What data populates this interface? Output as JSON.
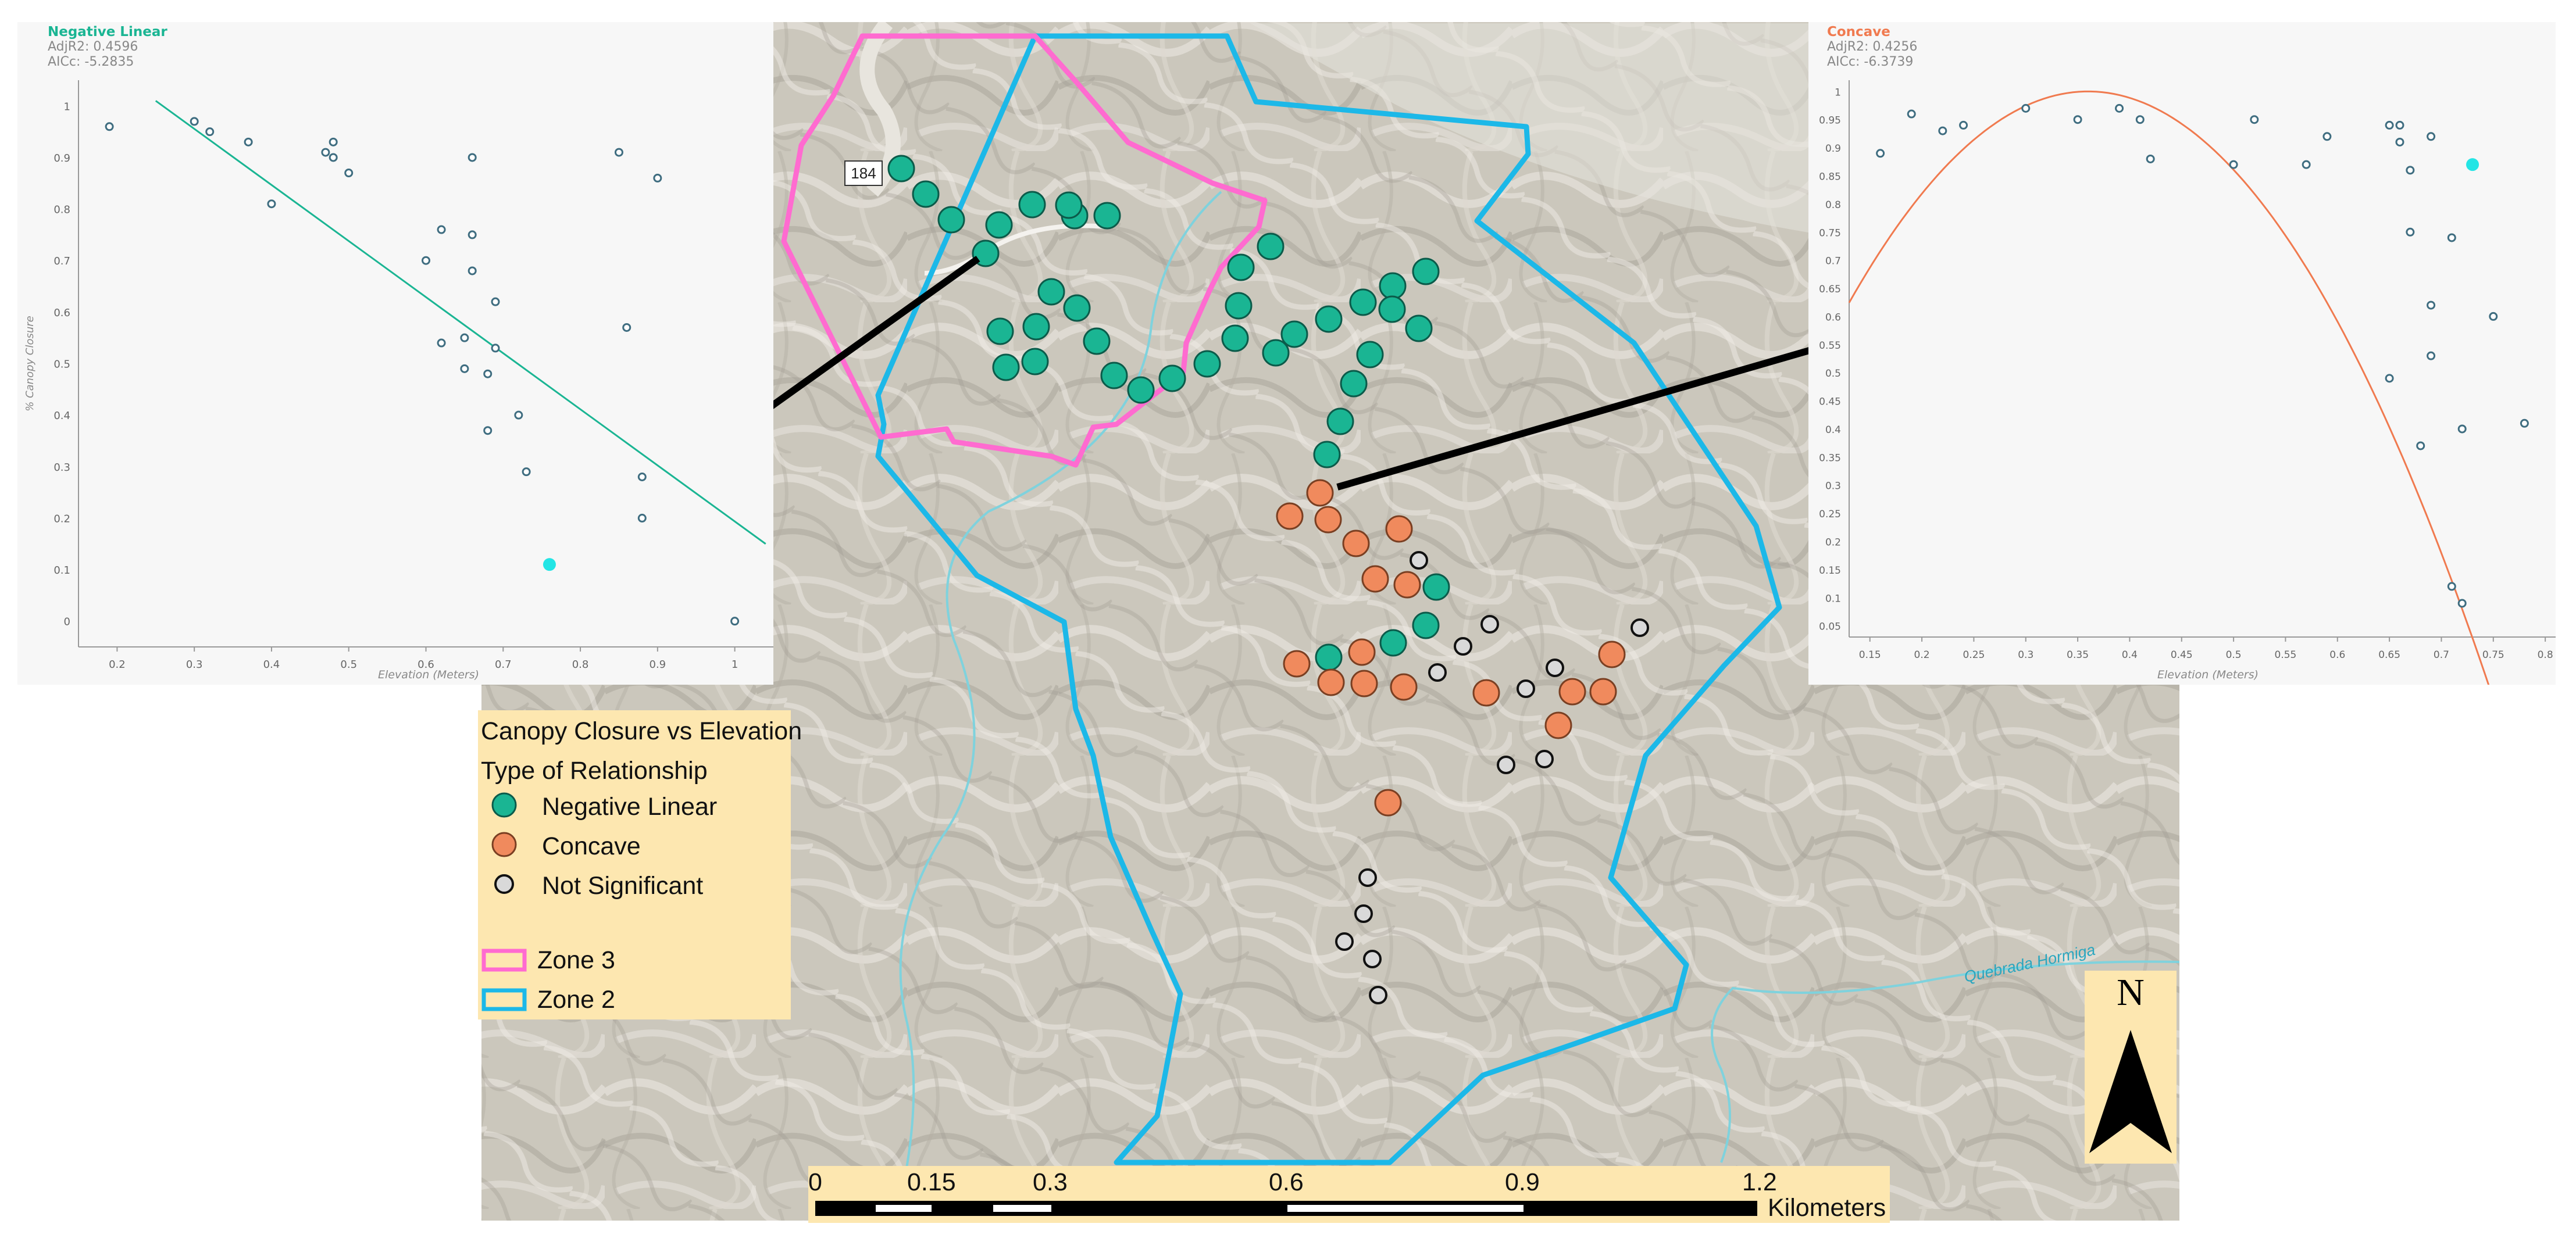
{
  "map": {
    "legend": {
      "title": "Canopy Closure vs Elevation",
      "subtitle": "Type of Relationship",
      "items": [
        {
          "label": "Negative Linear",
          "icon": "teal-filled-circle",
          "color": "#1ab593"
        },
        {
          "label": "Concave",
          "icon": "orange-filled-circle",
          "color": "#f08a5d"
        },
        {
          "label": "Not Significant",
          "icon": "hollow-circle",
          "color": "#d9d9d9"
        },
        {
          "label": "Zone 3",
          "icon": "pink-outline-box",
          "color": "#ff6bd0"
        },
        {
          "label": "Zone 2",
          "icon": "blue-outline-box",
          "color": "#1cb8e8"
        }
      ]
    },
    "scale_bar": {
      "ticks": [
        "0",
        "0.15",
        "0.3",
        "0.6",
        "0.9",
        "1.2"
      ],
      "unit": "Kilometers"
    },
    "north_arrow": {
      "label": "N"
    },
    "road_label": "184",
    "river_label": "Quebrada Hormiga"
  },
  "chart_data": [
    {
      "type": "scatter",
      "title": "Negative Linear",
      "stats": [
        "AdjR2: 0.4596",
        "AICc: -5.2835"
      ],
      "xlabel": "Elevation (Meters)",
      "ylabel": "% Canopy Closure",
      "xlim": [
        0.15,
        1.05
      ],
      "ylim": [
        -0.05,
        1.05
      ],
      "xticks": [
        "0.2",
        "0.3",
        "0.4",
        "0.5",
        "0.6",
        "0.7",
        "0.8",
        "0.9",
        "1"
      ],
      "yticks": [
        "0",
        "0.1",
        "0.2",
        "0.3",
        "0.4",
        "0.5",
        "0.6",
        "0.7",
        "0.8",
        "0.9",
        "1"
      ],
      "grid": false,
      "points": [
        {
          "x": 0.19,
          "y": 0.96
        },
        {
          "x": 0.3,
          "y": 0.97
        },
        {
          "x": 0.32,
          "y": 0.95
        },
        {
          "x": 0.37,
          "y": 0.93
        },
        {
          "x": 0.4,
          "y": 0.81
        },
        {
          "x": 0.47,
          "y": 0.91
        },
        {
          "x": 0.48,
          "y": 0.93
        },
        {
          "x": 0.48,
          "y": 0.9
        },
        {
          "x": 0.5,
          "y": 0.87
        },
        {
          "x": 0.6,
          "y": 0.7
        },
        {
          "x": 0.62,
          "y": 0.76
        },
        {
          "x": 0.62,
          "y": 0.54
        },
        {
          "x": 0.65,
          "y": 0.55
        },
        {
          "x": 0.65,
          "y": 0.49
        },
        {
          "x": 0.66,
          "y": 0.9
        },
        {
          "x": 0.66,
          "y": 0.75
        },
        {
          "x": 0.66,
          "y": 0.68
        },
        {
          "x": 0.68,
          "y": 0.48
        },
        {
          "x": 0.68,
          "y": 0.37
        },
        {
          "x": 0.69,
          "y": 0.62
        },
        {
          "x": 0.69,
          "y": 0.53
        },
        {
          "x": 0.72,
          "y": 0.4
        },
        {
          "x": 0.73,
          "y": 0.29
        },
        {
          "x": 0.85,
          "y": 0.91
        },
        {
          "x": 0.86,
          "y": 0.57
        },
        {
          "x": 0.88,
          "y": 0.28
        },
        {
          "x": 0.88,
          "y": 0.2
        },
        {
          "x": 0.9,
          "y": 0.86
        },
        {
          "x": 1.0,
          "y": 0.0
        }
      ],
      "highlight": {
        "x": 0.76,
        "y": 0.11,
        "color": "#23e5e5"
      },
      "fit": {
        "type": "linear",
        "color": "#1ab593",
        "from": [
          0.25,
          1.01
        ],
        "to": [
          1.04,
          0.15
        ]
      }
    },
    {
      "type": "scatter",
      "title": "Concave",
      "stats": [
        "AdjR2: 0.4256",
        "AICc: -6.3739"
      ],
      "xlabel": "Elevation (Meters)",
      "ylabel": "% Canopy Closure",
      "xlim": [
        0.13,
        0.81
      ],
      "ylim": [
        0.03,
        1.02
      ],
      "xticks": [
        "0.15",
        "0.2",
        "0.25",
        "0.3",
        "0.35",
        "0.4",
        "0.45",
        "0.5",
        "0.55",
        "0.6",
        "0.65",
        "0.7",
        "0.75",
        "0.8"
      ],
      "yticks": [
        "0.05",
        "0.1",
        "0.15",
        "0.2",
        "0.25",
        "0.3",
        "0.35",
        "0.4",
        "0.45",
        "0.5",
        "0.55",
        "0.6",
        "0.65",
        "0.7",
        "0.75",
        "0.8",
        "0.85",
        "0.9",
        "0.95",
        "1"
      ],
      "grid": false,
      "points": [
        {
          "x": 0.16,
          "y": 0.89
        },
        {
          "x": 0.19,
          "y": 0.96
        },
        {
          "x": 0.22,
          "y": 0.93
        },
        {
          "x": 0.24,
          "y": 0.94
        },
        {
          "x": 0.3,
          "y": 0.97
        },
        {
          "x": 0.35,
          "y": 0.95
        },
        {
          "x": 0.39,
          "y": 0.97
        },
        {
          "x": 0.41,
          "y": 0.95
        },
        {
          "x": 0.42,
          "y": 0.88
        },
        {
          "x": 0.5,
          "y": 0.87
        },
        {
          "x": 0.52,
          "y": 0.95
        },
        {
          "x": 0.57,
          "y": 0.87
        },
        {
          "x": 0.59,
          "y": 0.92
        },
        {
          "x": 0.65,
          "y": 0.49
        },
        {
          "x": 0.65,
          "y": 0.94
        },
        {
          "x": 0.66,
          "y": 0.94
        },
        {
          "x": 0.66,
          "y": 0.91
        },
        {
          "x": 0.67,
          "y": 0.86
        },
        {
          "x": 0.67,
          "y": 0.75
        },
        {
          "x": 0.68,
          "y": 0.37
        },
        {
          "x": 0.69,
          "y": 0.92
        },
        {
          "x": 0.69,
          "y": 0.62
        },
        {
          "x": 0.69,
          "y": 0.53
        },
        {
          "x": 0.71,
          "y": 0.74
        },
        {
          "x": 0.71,
          "y": 0.12
        },
        {
          "x": 0.72,
          "y": 0.4
        },
        {
          "x": 0.72,
          "y": 0.09
        },
        {
          "x": 0.75,
          "y": 0.6
        },
        {
          "x": 0.78,
          "y": 0.41
        }
      ],
      "highlight": {
        "x": 0.73,
        "y": 0.87,
        "color": "#23e5e5"
      },
      "fit": {
        "type": "quadratic",
        "color": "#f07a4f",
        "vertex": [
          0.36,
          1.0
        ],
        "a": -7.1
      }
    }
  ]
}
